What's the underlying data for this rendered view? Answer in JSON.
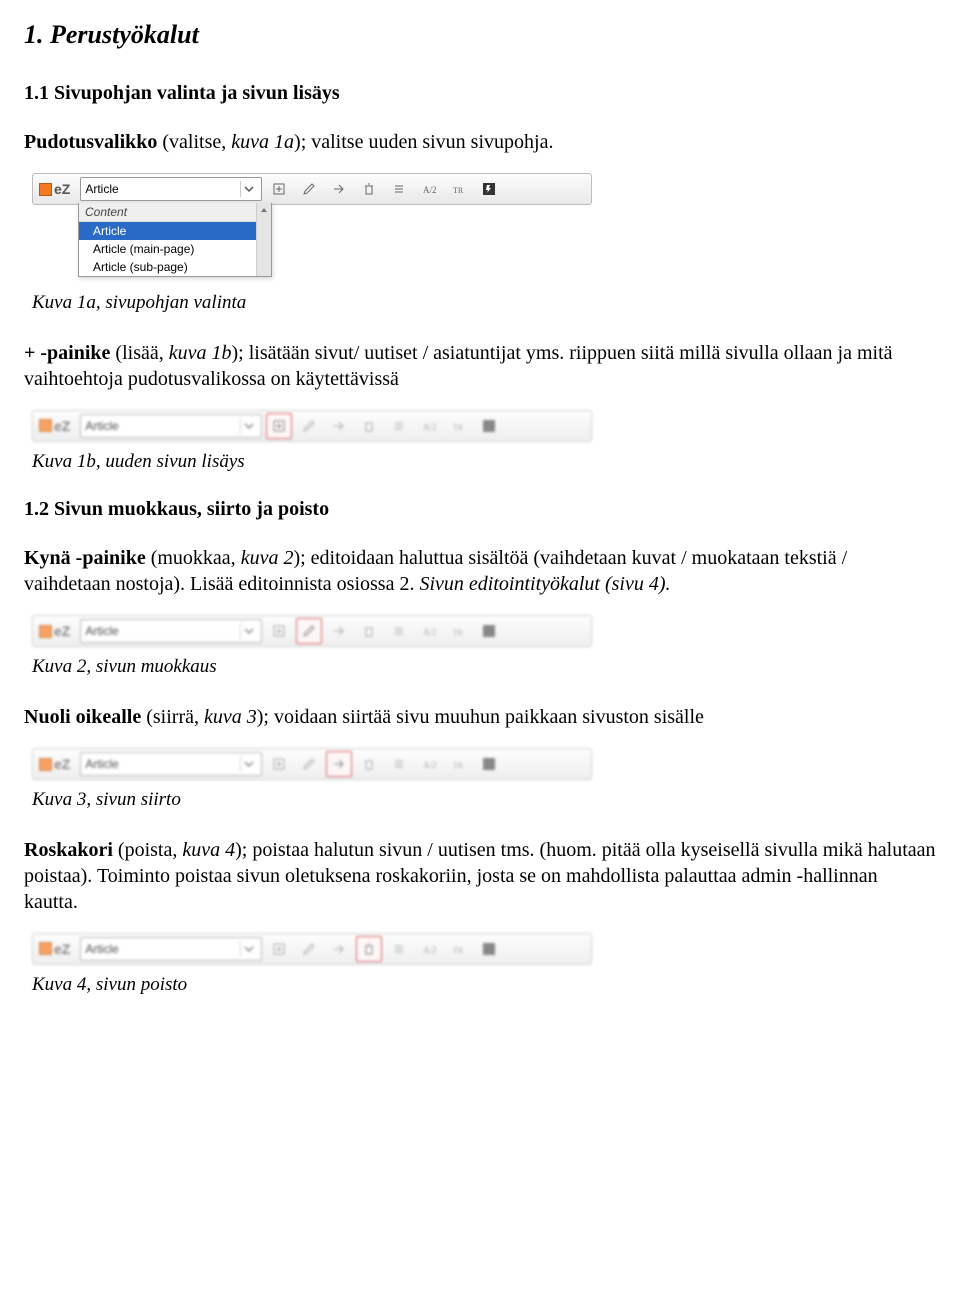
{
  "title": "1. Perustyökalut",
  "s11_heading": "1.1 Sivupohjan valinta ja sivun lisäys",
  "p_dropdown_intro_html": "<b>Pudotusvalikko</b> (valitse, <i>kuva 1a</i>); valitse uuden sivun sivupohja.",
  "caption_1a": "Kuva 1a, sivupohjan valinta",
  "p_plus_html": "<b>+ -painike</b> (lisää, <i>kuva 1b</i>); lisätään sivut/ uutiset / asiatuntijat yms. riippuen siitä millä sivulla ollaan ja mitä vaihtoehtoja pudotusvalikossa on käytettävissä",
  "caption_1b": "Kuva 1b, uuden sivun lisäys",
  "s12_heading": "1.2 Sivun muokkaus, siirto ja poisto",
  "p_edit_html": "<b>Kynä -painike</b> (muokkaa, <i>kuva 2</i>); editoidaan haluttua sisältöä (vaihdetaan kuvat / muokataan tekstiä / vaihdetaan nostoja). Lisää editoinnista osiossa 2. <i>Sivun editointityökalut (sivu 4).</i>",
  "caption_2": "Kuva 2, sivun muokkaus",
  "p_move_html": "<b>Nuoli oikealle</b> (siirrä, <i>kuva 3</i>); voidaan siirtää sivu muuhun paikkaan sivuston sisälle",
  "caption_3": "Kuva 3, sivun siirto",
  "p_delete_html": "<b>Roskakori</b> (poista, <i>kuva 4</i>);  poistaa halutun sivun / uutisen tms. (huom. pitää olla kyseisellä sivulla mikä halutaan poistaa). Toiminto poistaa sivun oletuksena roskakoriin, josta se on mahdollista palauttaa admin -hallinnan kautta.",
  "caption_4": "Kuva 4, sivun poisto",
  "toolbar": {
    "logo_text": "eZ",
    "select_value": "Article",
    "dropdown": {
      "group": "Content",
      "options": [
        "Article",
        "Article (main-page)",
        "Article (sub-page)"
      ]
    }
  }
}
